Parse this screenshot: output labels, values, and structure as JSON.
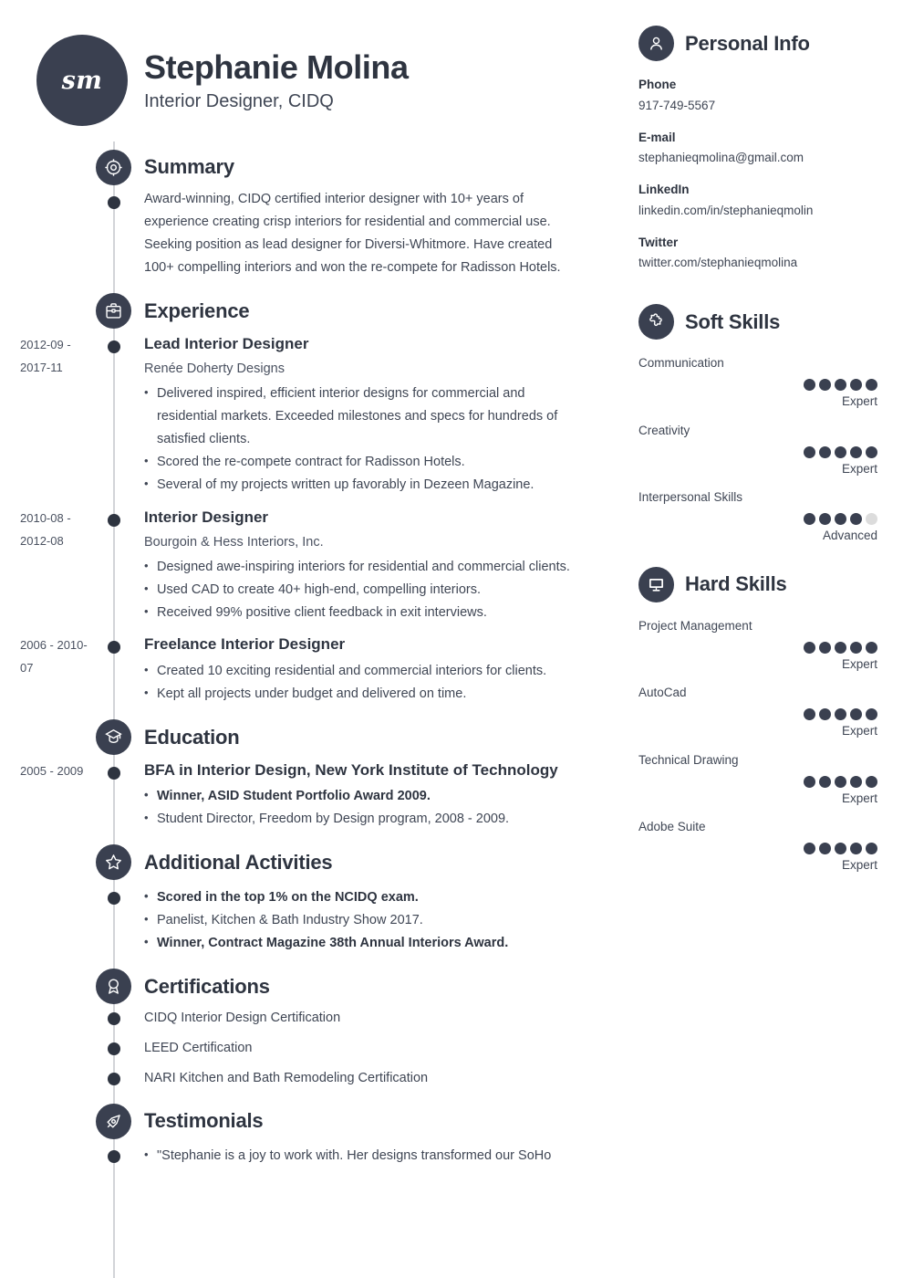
{
  "header": {
    "monogram": "sm",
    "name": "Stephanie Molina",
    "job_title": "Interior Designer, CIDQ"
  },
  "theme": {
    "accent": "#3a4050",
    "text": "#3f4654",
    "heading": "#2e3440",
    "rail": "#d2d4d8",
    "dot_off": "#dcdcdc"
  },
  "summary": {
    "title": "Summary",
    "icon": "target-icon",
    "text": "Award-winning, CIDQ certified interior designer with 10+ years of experience creating crisp interiors for residential and commercial use. Seeking position as lead designer for Diversi-Whitmore. Have created 100+ compelling interiors and won the re-compete for Radisson Hotels."
  },
  "experience": {
    "title": "Experience",
    "icon": "briefcase-icon",
    "entries": [
      {
        "date": "2012-09 - 2017-11",
        "title": "Lead Interior Designer",
        "company": "Renée Doherty Designs",
        "bullets": [
          {
            "text": "Delivered inspired, efficient interior designs for commercial and residential markets. Exceeded milestones and specs for hundreds of satisfied clients.",
            "bold": false
          },
          {
            "text": "Scored the re-compete contract for Radisson Hotels.",
            "bold": false
          },
          {
            "text": "Several of my projects written up favorably in Dezeen Magazine.",
            "bold": false
          }
        ]
      },
      {
        "date": "2010-08 - 2012-08",
        "title": "Interior Designer",
        "company": "Bourgoin & Hess Interiors, Inc.",
        "bullets": [
          {
            "text": "Designed awe-inspiring interiors for residential and commercial clients.",
            "bold": false
          },
          {
            "text": "Used CAD to create 40+ high-end, compelling interiors.",
            "bold": false
          },
          {
            "text": "Received 99% positive client feedback in exit interviews.",
            "bold": false
          }
        ]
      },
      {
        "date": "2006 - 2010-07",
        "title": "Freelance Interior Designer",
        "company": "",
        "bullets": [
          {
            "text": "Created 10 exciting residential and commercial interiors for clients.",
            "bold": false
          },
          {
            "text": "Kept all projects under budget and delivered on time.",
            "bold": false
          }
        ]
      }
    ]
  },
  "education": {
    "title": "Education",
    "icon": "graduation-cap-icon",
    "entries": [
      {
        "date": "2005 - 2009",
        "title": "BFA in Interior Design, New York Institute of Technology",
        "company": "",
        "bullets": [
          {
            "text": "Winner, ASID Student Portfolio Award 2009.",
            "bold": true
          },
          {
            "text": "Student Director, Freedom by Design program, 2008 - 2009.",
            "bold": false
          }
        ]
      }
    ]
  },
  "activities": {
    "title": "Additional Activities",
    "icon": "star-icon",
    "bullets": [
      {
        "text": "Scored in the top 1% on the NCIDQ exam.",
        "bold": true
      },
      {
        "text": "Panelist, Kitchen & Bath Industry Show 2017.",
        "bold": false
      },
      {
        "text": "Winner, Contract Magazine 38th Annual Interiors Award.",
        "bold": true
      }
    ]
  },
  "certifications": {
    "title": "Certifications",
    "icon": "award-ribbon-icon",
    "items": [
      "CIDQ Interior Design Certification",
      "LEED Certification",
      "NARI Kitchen and Bath Remodeling Certification"
    ]
  },
  "testimonials": {
    "title": "Testimonials",
    "icon": "pen-nib-icon",
    "bullets": [
      {
        "text": "\"Stephanie is a joy to work with. Her designs transformed our SoHo",
        "bold": false
      }
    ]
  },
  "personal_info": {
    "title": "Personal Info",
    "icon": "person-icon",
    "items": [
      {
        "label": "Phone",
        "value": "917-749-5567"
      },
      {
        "label": "E-mail",
        "value": "stephanieqmolina@gmail.com"
      },
      {
        "label": "LinkedIn",
        "value": "linkedin.com/in/stephanieqmolin"
      },
      {
        "label": "Twitter",
        "value": "twitter.com/stephanieqmolina"
      }
    ]
  },
  "soft_skills": {
    "title": "Soft Skills",
    "icon": "puzzle-piece-icon",
    "max_dots": 5,
    "items": [
      {
        "name": "Communication",
        "filled": 5,
        "level": "Expert"
      },
      {
        "name": "Creativity",
        "filled": 5,
        "level": "Expert"
      },
      {
        "name": "Interpersonal Skills",
        "filled": 4,
        "level": "Advanced"
      }
    ]
  },
  "hard_skills": {
    "title": "Hard Skills",
    "icon": "monitor-icon",
    "max_dots": 5,
    "items": [
      {
        "name": "Project Management",
        "filled": 5,
        "level": "Expert"
      },
      {
        "name": "AutoCad",
        "filled": 5,
        "level": "Expert"
      },
      {
        "name": "Technical Drawing",
        "filled": 5,
        "level": "Expert"
      },
      {
        "name": "Adobe Suite",
        "filled": 5,
        "level": "Expert"
      }
    ]
  }
}
